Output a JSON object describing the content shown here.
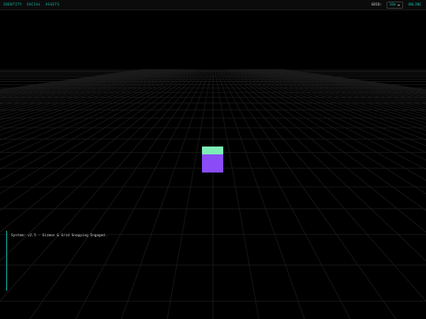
{
  "nav": {
    "items": [
      {
        "label": "IDENTITY"
      },
      {
        "label": "SOCIAL"
      },
      {
        "label": "ASSETS"
      }
    ]
  },
  "controls": {
    "grid_label": "GRID:",
    "grid_value": "10m",
    "status": "ONLINE"
  },
  "console": {
    "line": "System: v2.5 - Gizmos & Grid Snapping Engaged."
  },
  "colors": {
    "accent": "#16b8a6",
    "cube_top": "#7dedb6",
    "cube_front": "#8a4cf6",
    "grid_line": "#1c1c1c",
    "background": "#000000"
  },
  "icons": {
    "dropdown": "chevron-down-icon"
  }
}
